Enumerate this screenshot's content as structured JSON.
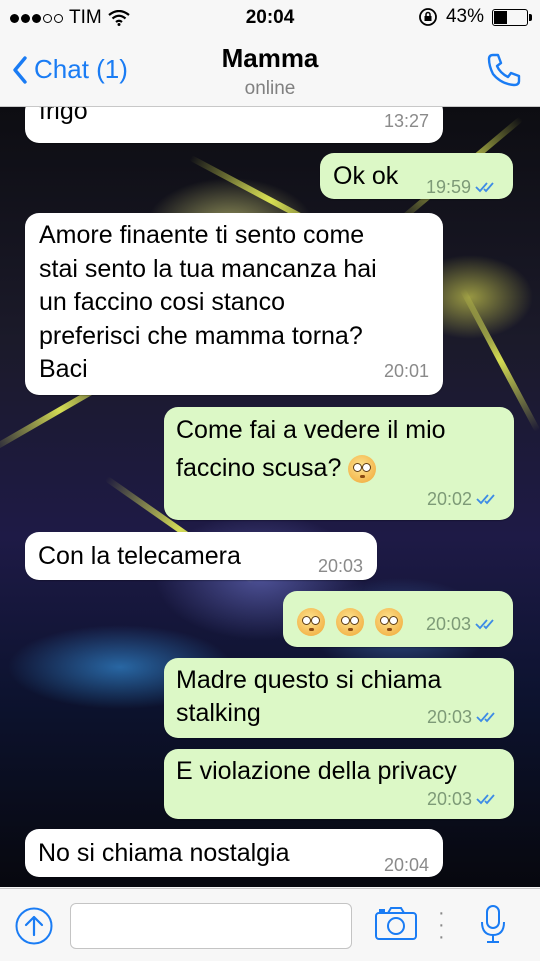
{
  "status_bar": {
    "carrier": "TIM",
    "time": "20:04",
    "battery": "43%",
    "battery_level": 0.43
  },
  "header": {
    "back_label": "Chat (1)",
    "contact_name": "Mamma",
    "contact_status": "online"
  },
  "messages": [
    {
      "direction": "in",
      "text": "frigo",
      "time": "13:27"
    },
    {
      "direction": "out",
      "text": "Ok ok",
      "time": "19:59",
      "read": true
    },
    {
      "direction": "in",
      "lines": [
        "Amore finaente ti sento come",
        "stai sento la tua mancanza hai",
        "un faccino cosi stanco",
        "preferisci che mamma torna?",
        "Baci"
      ],
      "time": "20:01"
    },
    {
      "direction": "out",
      "lines": [
        "Come fai a vedere il mio",
        "faccino scusa?"
      ],
      "emoji": "flushed-face",
      "time": "20:02",
      "read": true
    },
    {
      "direction": "in",
      "text": "Con la telecamera",
      "time": "20:03"
    },
    {
      "direction": "out",
      "emoji": "flushed-face",
      "emoji_count": 3,
      "time": "20:03",
      "read": true
    },
    {
      "direction": "out",
      "lines": [
        "Madre questo si chiama",
        "stalking"
      ],
      "time": "20:03",
      "read": true
    },
    {
      "direction": "out",
      "text": "E violazione della privacy",
      "time": "20:03",
      "read": true
    },
    {
      "direction": "in",
      "text": "No si chiama nostalgia",
      "time": "20:04"
    }
  ],
  "input": {
    "placeholder": ""
  },
  "colors": {
    "accent": "#1a7cf4",
    "outgoing_bubble": "#dcf8c6",
    "incoming_bubble": "#ffffff",
    "read_ticks": "#3d8be6"
  },
  "icons": [
    "signal-dots-icon",
    "wifi-icon",
    "orientation-lock-icon",
    "battery-icon",
    "chevron-left-icon",
    "phone-icon",
    "double-check-icon",
    "flushed-face-emoji",
    "upload-arrow-icon",
    "camera-icon",
    "more-dots-icon",
    "microphone-icon"
  ]
}
